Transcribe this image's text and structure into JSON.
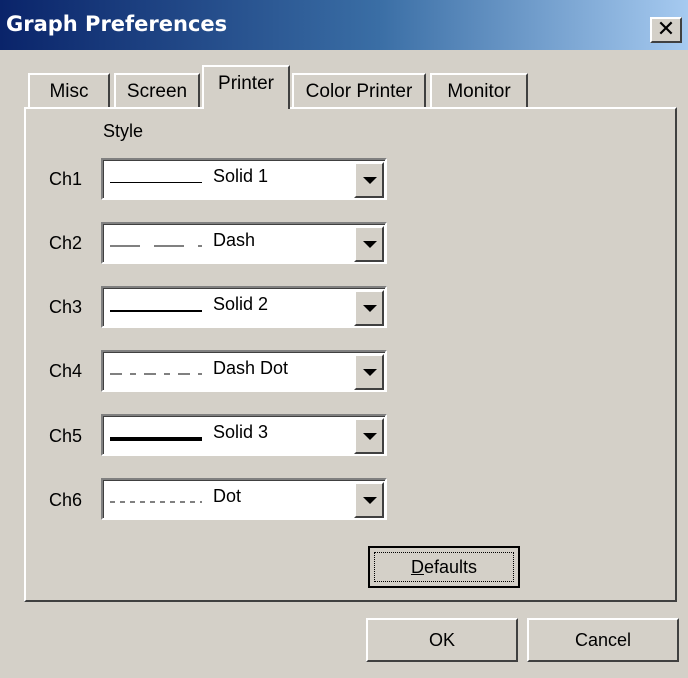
{
  "window": {
    "title": "Graph Preferences",
    "close_glyph": "✕"
  },
  "tabs": [
    {
      "label": "Misc",
      "active": false
    },
    {
      "label": "Screen",
      "active": false
    },
    {
      "label": "Printer",
      "active": true
    },
    {
      "label": "Color Printer",
      "active": false
    },
    {
      "label": "Monitor",
      "active": false
    }
  ],
  "panel": {
    "column_header": "Style",
    "channels": [
      {
        "label": "Ch1",
        "style": "Solid 1",
        "line": "solid-thin"
      },
      {
        "label": "Ch2",
        "style": "Dash",
        "line": "dash"
      },
      {
        "label": "Ch3",
        "style": "Solid 2",
        "line": "solid-medium"
      },
      {
        "label": "Ch4",
        "style": "Dash Dot",
        "line": "dash-dot"
      },
      {
        "label": "Ch5",
        "style": "Solid 3",
        "line": "solid-thick"
      },
      {
        "label": "Ch6",
        "style": "Dot",
        "line": "dot"
      }
    ],
    "defaults_button": {
      "label_mnemonic": "D",
      "label_rest": "efaults"
    }
  },
  "buttons": {
    "ok": "OK",
    "cancel": "Cancel"
  },
  "colors": {
    "face": "#d4d0c8",
    "titlebar_start": "#0a246a",
    "titlebar_end": "#a6caf0"
  }
}
